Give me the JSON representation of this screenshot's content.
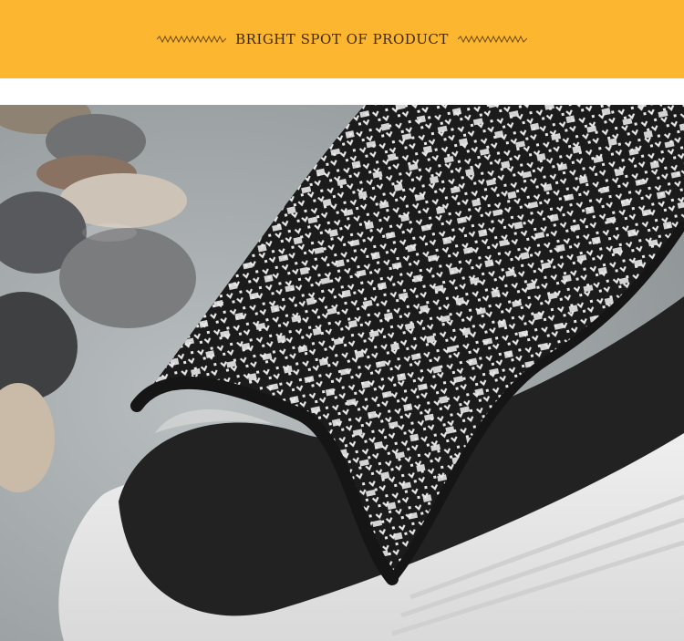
{
  "banner": {
    "title": "BRIGHT SPOT OF PRODUCT",
    "background_color": "#fdb62f",
    "ornament_icon": "zigzag-line-icon"
  },
  "photo": {
    "subject": "knit-sandal-icon",
    "colors": {
      "knit_dark": "#1b1b1b",
      "knit_light": "#e9e9e9",
      "insole": "#222222",
      "sole": "#f3f3f3",
      "surface": "#a6acad"
    }
  }
}
